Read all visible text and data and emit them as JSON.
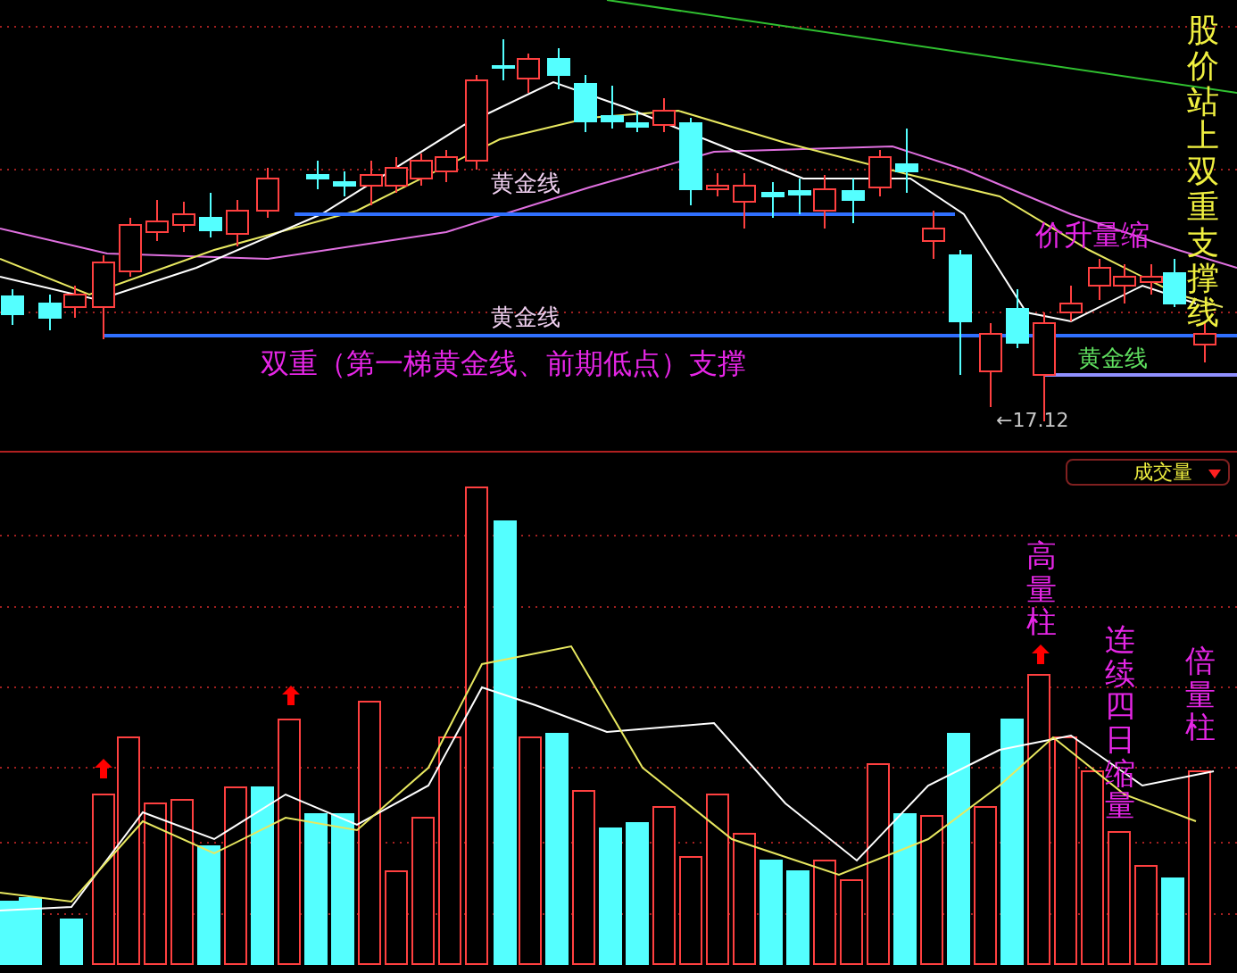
{
  "price_panel": {
    "golden_line_labels": [
      "黄金线",
      "黄金线",
      "黄金线"
    ],
    "support_caption": "双重（第一梯黄金线、前期低点）支撑",
    "divergence_note": "价升量缩",
    "side_note": "股价站上双重支撑线",
    "low_marker": "←17.12"
  },
  "volume_panel": {
    "indicator_selector": "成交量",
    "notes": [
      "高量柱",
      "连续四日缩量",
      "倍量柱"
    ]
  }
}
